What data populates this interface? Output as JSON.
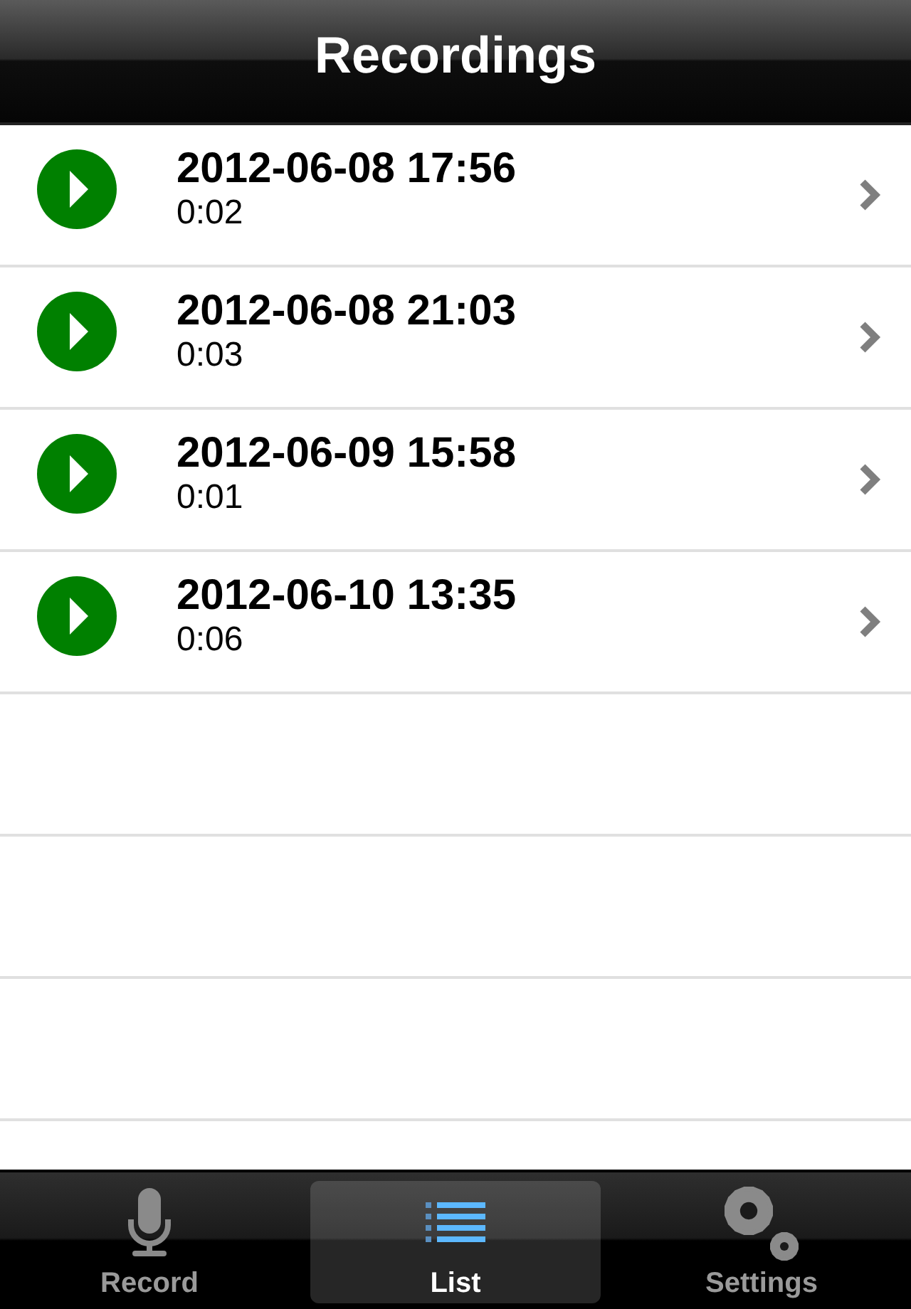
{
  "navigation_bar": {
    "title": "Recordings"
  },
  "recordings": [
    {
      "date": "2012-06-08 17:56",
      "duration": "0:02"
    },
    {
      "date": "2012-06-08 21:03",
      "duration": "0:03"
    },
    {
      "date": "2012-06-09 15:58",
      "duration": "0:01"
    },
    {
      "date": "2012-06-10 13:35",
      "duration": "0:06"
    }
  ],
  "tab_bar": [
    {
      "label": "Record",
      "kind": "mic",
      "selected": false
    },
    {
      "label": "List",
      "kind": "list",
      "selected": true
    },
    {
      "label": "Settings",
      "kind": "gear",
      "selected": false
    }
  ]
}
